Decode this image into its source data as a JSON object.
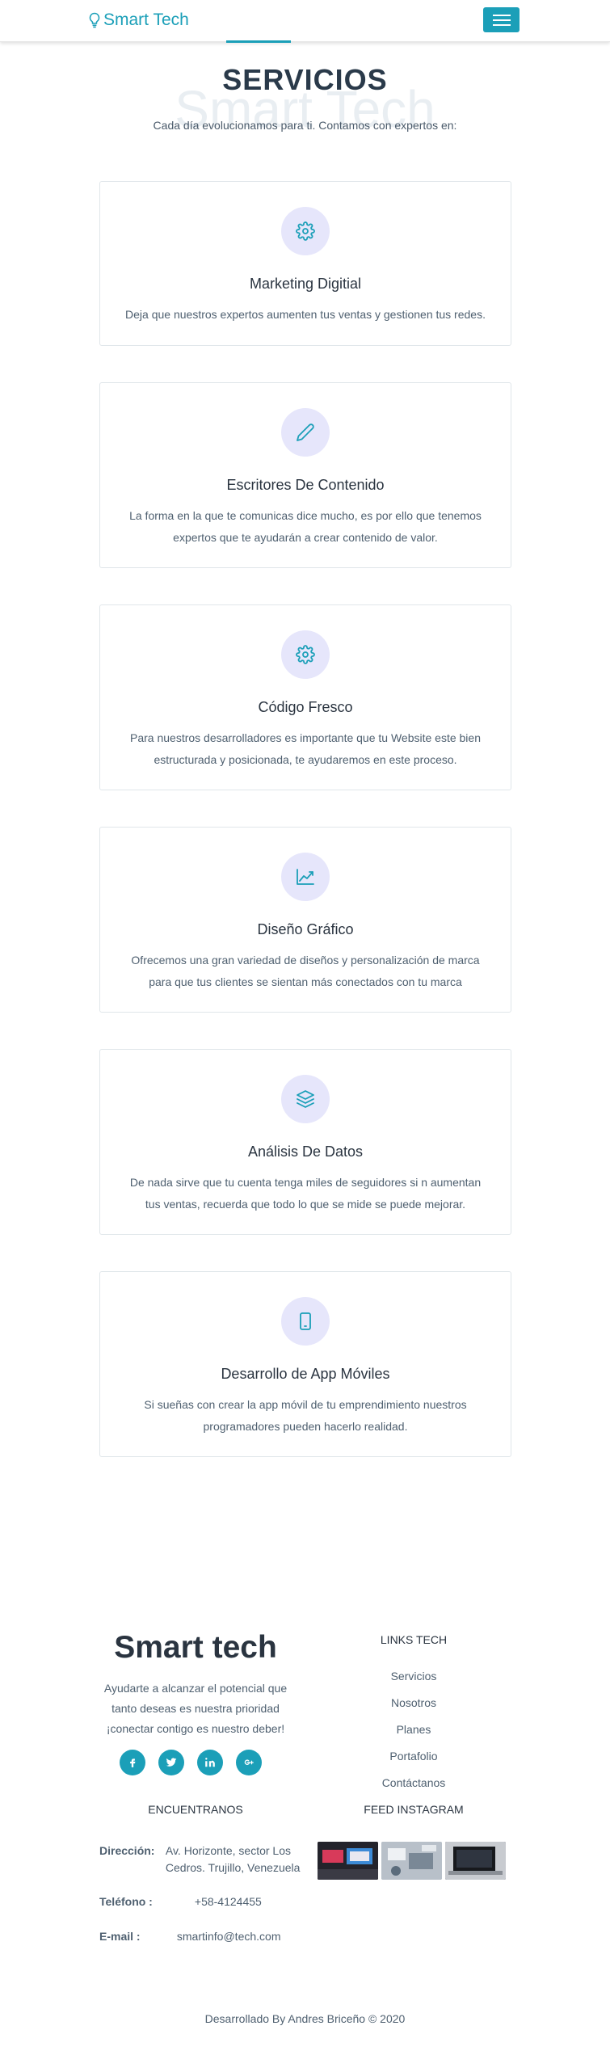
{
  "navbar": {
    "brand": "Smart Tech"
  },
  "services": {
    "title": "SERVICIOS",
    "watermark": "Smart Tech",
    "subtitle": "Cada día evolucionamos para ti. Contamos con expertos en:",
    "items": [
      {
        "icon": "gear-icon",
        "title": "Marketing Digitial",
        "text": "Deja que nuestros expertos aumenten tus ventas y gestionen tus redes."
      },
      {
        "icon": "pencil-icon",
        "title": "Escritores De Contenido",
        "text": "La forma en la que te comunicas dice mucho, es por ello que tenemos expertos que te ayudarán a crear contenido de valor."
      },
      {
        "icon": "gear-icon",
        "title": "Código Fresco",
        "text": "Para nuestros desarrolladores es importante que tu Website este bien estructurada y posicionada, te ayudaremos en este proceso."
      },
      {
        "icon": "chart-line-icon",
        "title": "Diseño Gráfico",
        "text": "Ofrecemos una gran variedad de diseños y personalización de marca para que tus clientes se sientan más conectados con tu marca"
      },
      {
        "icon": "layers-icon",
        "title": "Análisis De Datos",
        "text": "De nada sirve que tu cuenta tenga miles de seguidores si n aumentan tus ventas, recuerda que todo lo que se mide se puede mejorar."
      },
      {
        "icon": "tablet-icon",
        "title": "Desarrollo de App Móviles",
        "text": "Si sueñas con crear la app móvil de tu emprendimiento nuestros programadores pueden hacerlo realidad."
      }
    ]
  },
  "footer": {
    "brand": "Smart tech",
    "tagline_1": "Ayudarte a alcanzar el potencial que",
    "tagline_2": "tanto deseas es nuestra prioridad",
    "tagline_3": "¡conectar contigo es nuestro deber!",
    "socials": [
      "facebook-icon",
      "twitter-icon",
      "linkedin-icon",
      "google-plus-icon"
    ],
    "links_title": "LINKS TECH",
    "links": [
      "Servicios",
      "Nosotros",
      "Planes",
      "Portafolio",
      "Contáctanos"
    ],
    "find_title": "ENCUENTRANOS",
    "insta_title": "FEED INSTAGRAM",
    "address_label": "Dirección:",
    "address_line1": "Av. Horizonte, sector Los",
    "address_line2": "Cedros. Trujillo, Venezuela",
    "phone_label": "Teléfono :",
    "phone": "+58-4124455",
    "email_label": "E-mail :",
    "email": "smartinfo@tech.com",
    "copyright": "Desarrollado By Andres Briceño © 2020"
  },
  "colors": {
    "accent": "#1b9fb8",
    "icon_bg": "#e6e6fb",
    "heading": "#2a3440"
  }
}
